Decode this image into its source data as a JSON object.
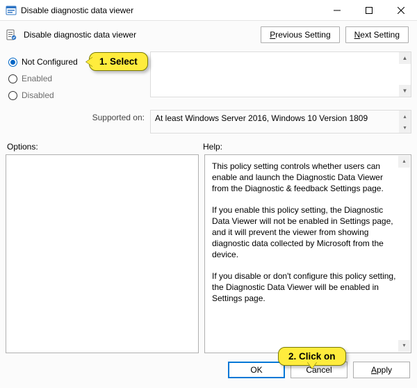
{
  "titlebar": {
    "title": "Disable diagnostic data viewer"
  },
  "subheader": {
    "title": "Disable diagnostic data viewer",
    "prev": "Previous Setting",
    "next": "Next Setting"
  },
  "radios": {
    "not_configured": "Not Configured",
    "enabled": "Enabled",
    "disabled": "Disabled"
  },
  "supported": {
    "label": "Supported on:",
    "value": "At least Windows Server 2016, Windows 10 Version 1809"
  },
  "labels": {
    "options": "Options:",
    "help": "Help:"
  },
  "help": {
    "p1": "This policy setting controls whether users can enable and launch the Diagnostic Data Viewer from the Diagnostic & feedback Settings page.",
    "p2": "If you enable this policy setting, the Diagnostic Data Viewer will not be enabled in Settings page, and it will prevent the viewer from showing diagnostic data collected by Microsoft from the device.",
    "p3": "If you disable or don't configure this policy setting, the Diagnostic Data Viewer will be enabled in Settings page."
  },
  "footer": {
    "ok": "OK",
    "cancel": "Cancel",
    "apply": "Apply"
  },
  "annotations": {
    "select": "1. Select",
    "click": "2. Click on"
  }
}
